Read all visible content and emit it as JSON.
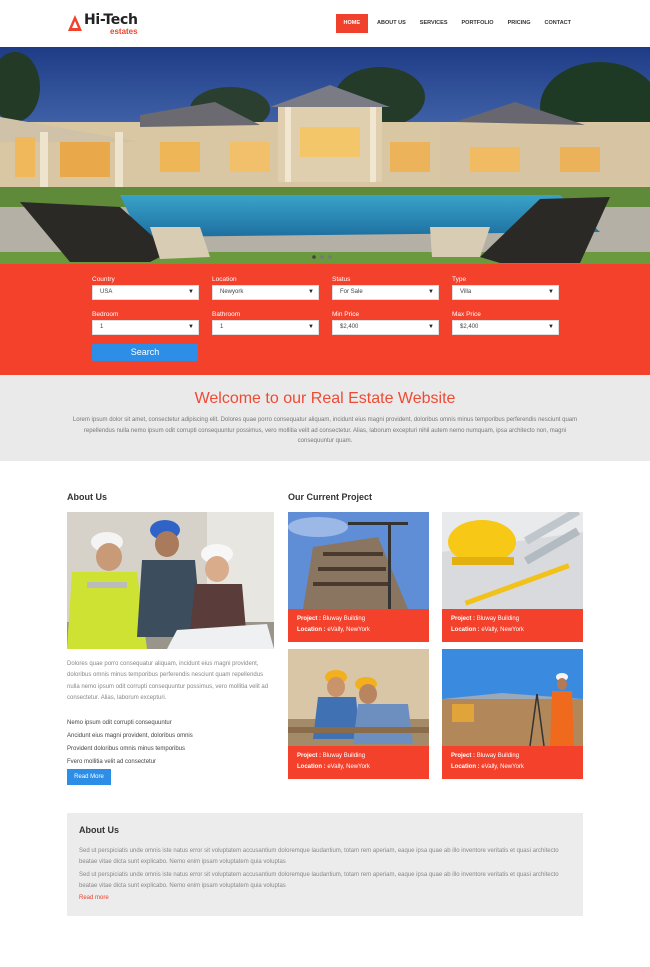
{
  "header": {
    "logo_title": "Hi-Tech",
    "logo_sub": "estates",
    "nav": [
      "HOME",
      "ABOUT US",
      "SERVICES",
      "PORTFOLIO",
      "PRICING",
      "CONTACT"
    ]
  },
  "search": {
    "fields": [
      {
        "label": "Country",
        "value": "USA"
      },
      {
        "label": "Location",
        "value": "Newyork"
      },
      {
        "label": "Status",
        "value": "For Sale"
      },
      {
        "label": "Type",
        "value": "Villa"
      },
      {
        "label": "Bedroom",
        "value": "1"
      },
      {
        "label": "Bathroom",
        "value": "1"
      },
      {
        "label": "Min Price",
        "value": "$2,400"
      },
      {
        "label": "Max Price",
        "value": "$2,400"
      }
    ],
    "button": "Search"
  },
  "welcome": {
    "title": "Welcome to our Real Estate Website",
    "text": "Lorem ipsum dolor sit amet, consectetur adipiscing elit. Dolores quae porro consequatur aliquam, incidunt eius magni provident, doloribus omnis minus temporibus perferendis nesciunt quam repellendus nulla nemo ipsum odit corrupti consequuntur possimus, vero mollitia velit ad consectetur. Alias, laborum excepturi nihil autem nemo numquam, ipsa architecto non, magni consequuntur quam."
  },
  "about": {
    "title": "About Us",
    "text": "Dolores quae porro consequatur aliquam, incidunt eius magni provident, doloribus omnis minus temporibus perferendis nesciunt quam repellendus nulla nemo ipsum odit corrupti consequuntur possimus, vero mollitia velit ad consectetur. Alias, laborum excepturi.",
    "list": [
      "Nemo ipsum odit corrupti consequuntur",
      "Ancidunt eius magni provident, doloribus omnis",
      "Provident doloribus omnis minus temporibus",
      "Fvero mollitia velit ad consectetur"
    ],
    "button": "Read More"
  },
  "projects": {
    "title": "Our Current Project",
    "project_label": "Project :",
    "location_label": "Location :",
    "items": [
      {
        "name": "Bluway Building",
        "location": "eVally, NewYork"
      },
      {
        "name": "Bluway Building",
        "location": "eVally, NewYork"
      },
      {
        "name": "Bluway Building",
        "location": "eVally, NewYork"
      },
      {
        "name": "Bluway Building",
        "location": "eVally, NewYork"
      }
    ]
  },
  "about_box": {
    "title": "About Us",
    "para1": "Sed ut perspiciatis unde omnis iste natus error sit voluptatem accusantium doloremque laudantium, totam rem aperiam, eaque ipsa quae ab illo inventore veritatis et quasi architecto beatae vitae dicta sunt explicabo. Nemo enim ipsam voluptatem quia voluptas",
    "para2": "Sed ut perspiciatis unde omnis iste natus error sit voluptatem accusantium doloremque laudantium, totam rem aperiam, eaque ipsa quae ab illo inventore veritatis et quasi architecto beatae vitae dicta sunt explicabo. Nemo enim ipsam voluptatem quia voluptas",
    "link": "Read more"
  },
  "colors": {
    "accent": "#f3412c",
    "button_blue": "#2d8ee8",
    "band_gray": "#eaeaea"
  },
  "icons": [
    "logo-triangle-icon",
    "chevron-down-icon"
  ]
}
